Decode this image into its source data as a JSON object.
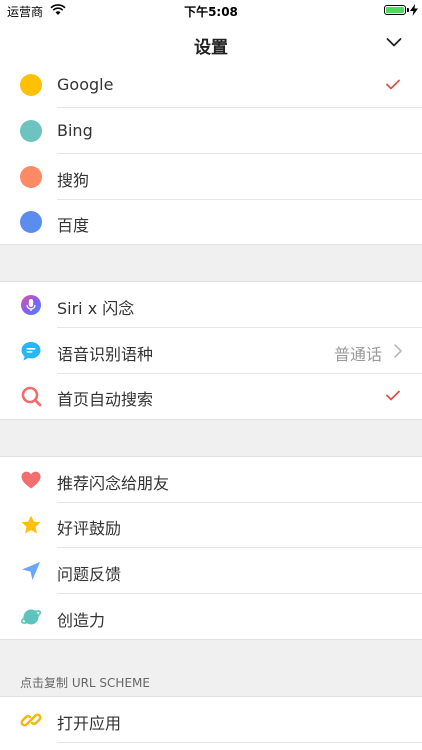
{
  "status_bar": {
    "carrier": "运营商",
    "time": "下午5:08",
    "battery_level": 1.0,
    "battery_color": "#4cd964"
  },
  "nav": {
    "title": "设置",
    "collapse_icon": "chevron-down-icon"
  },
  "search_engines": [
    {
      "label": "Google",
      "color": "#ffc107",
      "selected": true
    },
    {
      "label": "Bing",
      "color": "#6cc3bf",
      "selected": false
    },
    {
      "label": "搜狗",
      "color": "#ff8a65",
      "selected": false
    },
    {
      "label": "百度",
      "color": "#5b8def",
      "selected": false
    }
  ],
  "features": {
    "siri": {
      "label": "Siri x 闪念",
      "icon": "siri-icon"
    },
    "voice_language": {
      "label": "语音识别语种",
      "value": "普通话",
      "icon": "chat-bubble-icon"
    },
    "home_search": {
      "label": "首页自动搜索",
      "icon": "search-icon",
      "checked": true
    }
  },
  "social": [
    {
      "label": "推荐闪念给朋友",
      "icon": "heart-icon",
      "color": "#f26d6d"
    },
    {
      "label": "好评鼓励",
      "icon": "star-icon",
      "color": "#ffc107"
    },
    {
      "label": "问题反馈",
      "icon": "send-icon",
      "color": "#6aa7f7"
    },
    {
      "label": "创造力",
      "icon": "planet-icon",
      "color": "#5cc4bd"
    }
  ],
  "url_scheme": {
    "header": "点击复制 URL SCHEME",
    "items": [
      {
        "label": "打开应用",
        "icon": "link-icon",
        "color": "#f5b800"
      }
    ]
  },
  "accent_color": "#d9534f"
}
